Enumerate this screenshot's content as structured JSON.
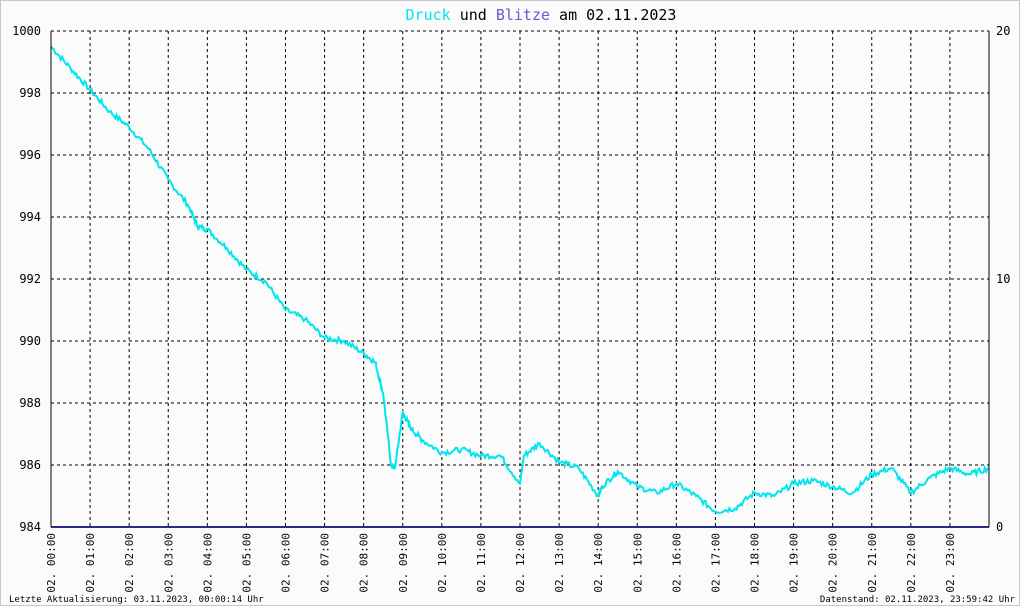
{
  "title": {
    "part1": "Druck",
    "part2": " und ",
    "part3": "Blitze",
    "part4": " am 02.11.2023",
    "color_druck": "#00e5ee",
    "color_blitze": "#6a5acd",
    "color_text": "#000000"
  },
  "footer": {
    "left": "Letzte Aktualisierung: 03.11.2023, 00:00:14 Uhr",
    "right": "Datenstand: 02.11.2023, 23:59:42 Uhr"
  },
  "chart_data": {
    "type": "line",
    "title": "Druck und Blitze am 02.11.2023",
    "grid": true,
    "x_range_hours": [
      0,
      24
    ],
    "x_tick_labels": [
      "02. 00:00",
      "02. 01:00",
      "02. 02:00",
      "02. 03:00",
      "02. 04:00",
      "02. 05:00",
      "02. 06:00",
      "02. 07:00",
      "02. 08:00",
      "02. 09:00",
      "02. 10:00",
      "02. 11:00",
      "02. 12:00",
      "02. 13:00",
      "02. 14:00",
      "02. 15:00",
      "02. 16:00",
      "02. 17:00",
      "02. 18:00",
      "02. 19:00",
      "02. 20:00",
      "02. 21:00",
      "02. 22:00",
      "02. 23:00"
    ],
    "y_left": {
      "min": 984,
      "max": 1000,
      "ticks": [
        "1000",
        "998",
        "996",
        "994",
        "992",
        "990",
        "988",
        "986",
        "984"
      ]
    },
    "y_right": {
      "min": 0,
      "max": 20,
      "ticks": [
        "20",
        "10",
        "0"
      ]
    },
    "series": [
      {
        "name": "Druck",
        "axis": "left",
        "color": "#00e5ee",
        "x": [
          0,
          0.5,
          1,
          1.5,
          2,
          2.5,
          3,
          3.5,
          3.75,
          4,
          4.5,
          5,
          5.5,
          6,
          6.5,
          7,
          7.5,
          8,
          8.3,
          8.5,
          8.7,
          8.8,
          9,
          9.2,
          9.5,
          10,
          10.5,
          11,
          11.5,
          12,
          12.1,
          12.5,
          13,
          13.5,
          14,
          14.1,
          14.5,
          15,
          15.5,
          16,
          16.5,
          17,
          17.5,
          18,
          18.5,
          19,
          19.5,
          20,
          20.5,
          21,
          21.5,
          22,
          22.5,
          23,
          23.5,
          24
        ],
        "y": [
          999.5,
          998.8,
          998.1,
          997.4,
          996.9,
          996.2,
          995.2,
          994.4,
          993.7,
          993.6,
          993.0,
          992.3,
          991.9,
          991.0,
          990.7,
          990.1,
          990.0,
          989.6,
          989.3,
          988.3,
          986.0,
          985.9,
          987.7,
          987.2,
          986.8,
          986.4,
          986.5,
          986.3,
          986.3,
          985.4,
          986.3,
          986.7,
          986.1,
          985.9,
          985.0,
          985.3,
          985.8,
          985.3,
          985.1,
          985.4,
          985.0,
          984.5,
          984.6,
          985.1,
          985.0,
          985.4,
          985.5,
          985.3,
          985.1,
          985.7,
          985.9,
          985.1,
          985.6,
          985.9,
          985.7,
          985.9
        ]
      },
      {
        "name": "Blitze",
        "axis": "right",
        "color": "#2a2a8a",
        "x": [
          0,
          24
        ],
        "y": [
          0,
          0
        ]
      }
    ]
  }
}
